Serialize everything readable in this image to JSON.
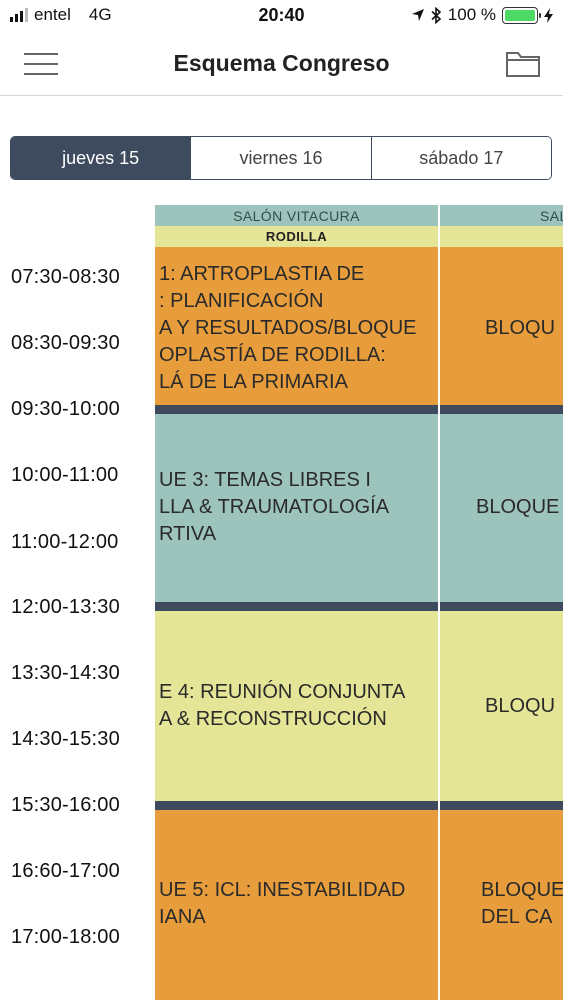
{
  "status_bar": {
    "carrier": "entel",
    "network": "4G",
    "time": "20:40",
    "battery": "100 %"
  },
  "nav": {
    "title": "Esquema Congreso"
  },
  "days": [
    "jueves 15",
    "viernes 16",
    "sábado 17"
  ],
  "times": [
    "07:30-08:30",
    "08:30-09:30",
    "09:30-10:00",
    "10:00-11:00",
    "11:00-12:00",
    "12:00-13:30",
    "13:30-14:30",
    "14:30-15:30",
    "15:30-16:00",
    "16:60-17:00",
    "17:00-18:00"
  ],
  "columns": [
    {
      "room": "SALÓN VITACURA",
      "topic": "RODILLA",
      "blocks": [
        [
          "1: ARTROPLASTIA DE",
          ": PLANIFICACIÓN",
          "A Y RESULTADOS/BLOQUE",
          "OPLASTÍA DE RODILLA:",
          "LÁ DE LA PRIMARIA"
        ],
        [
          "UE 3: TEMAS LIBRES I",
          "LLA & TRAUMATOLOGÍA",
          "RTIVA"
        ],
        [
          "E 4: REUNIÓN CONJUNTA",
          "A & RECONSTRUCCIÓN"
        ],
        [
          "UE 5: ICL: INESTABILIDAD",
          "IANA"
        ]
      ]
    },
    {
      "room": "SAL",
      "topic": "",
      "blocks": [
        [
          "BLOQU"
        ],
        [
          "BLOQUE"
        ],
        [
          "BLOQU"
        ],
        [
          "BLOQUE",
          "DEL CA"
        ]
      ]
    }
  ],
  "colors": {
    "orange": "#e79d3c",
    "teal": "#9dc3bd",
    "yellow": "#e4e597",
    "navy": "#3e4a5e"
  }
}
